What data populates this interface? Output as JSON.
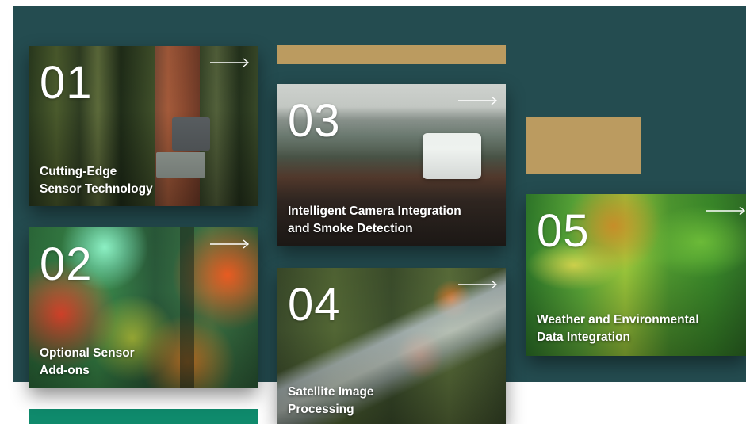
{
  "cards": [
    {
      "number": "01",
      "title": "Cutting-Edge\nSensor Technology"
    },
    {
      "number": "02",
      "title": "Optional Sensor\nAdd-ons"
    },
    {
      "number": "03",
      "title": "Intelligent Camera Integration\nand Smoke Detection"
    },
    {
      "number": "04",
      "title": "Satellite Image\nProcessing"
    },
    {
      "number": "05",
      "title": "Weather and Environmental\nData Integration"
    }
  ],
  "icons": {
    "arrow": "arrow-right-icon"
  },
  "colors": {
    "background_panel": "#244c50",
    "gold_accent": "#bb9b60",
    "green_accent": "#0f8a6c",
    "text": "#ffffff"
  }
}
